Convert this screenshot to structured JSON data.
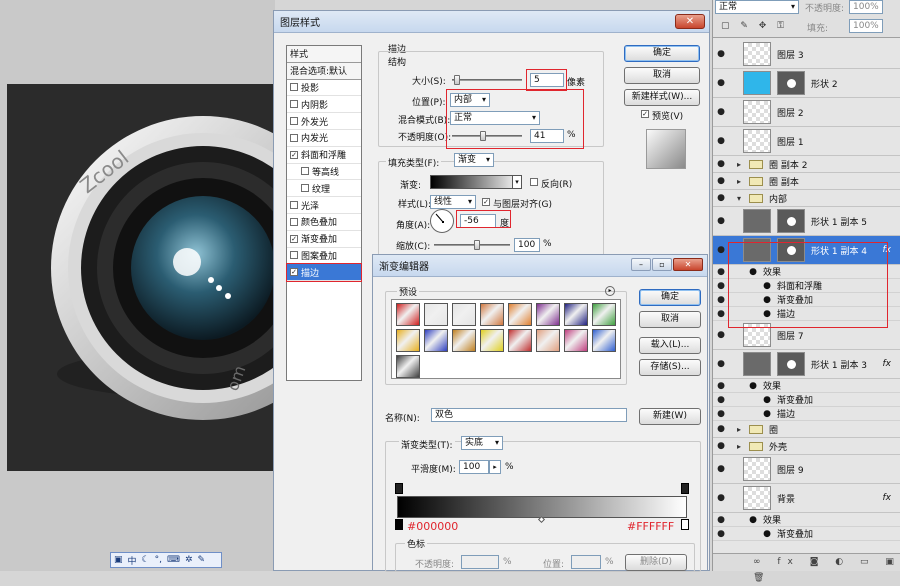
{
  "layer_style": {
    "title": "图层样式",
    "styles_header": "样式",
    "blend_options": "混合选项:默认",
    "items": [
      {
        "label": "投影",
        "checked": false,
        "sub": false
      },
      {
        "label": "内阴影",
        "checked": false,
        "sub": false
      },
      {
        "label": "外发光",
        "checked": false,
        "sub": false
      },
      {
        "label": "内发光",
        "checked": false,
        "sub": false
      },
      {
        "label": "斜面和浮雕",
        "checked": true,
        "sub": false
      },
      {
        "label": "等高线",
        "checked": false,
        "sub": true
      },
      {
        "label": "纹理",
        "checked": false,
        "sub": true
      },
      {
        "label": "光泽",
        "checked": false,
        "sub": false
      },
      {
        "label": "颜色叠加",
        "checked": false,
        "sub": false
      },
      {
        "label": "渐变叠加",
        "checked": true,
        "sub": false
      },
      {
        "label": "图案叠加",
        "checked": false,
        "sub": false
      },
      {
        "label": "描边",
        "checked": true,
        "sub": false,
        "selected": true
      }
    ],
    "stroke": {
      "section_title": "描边",
      "structure_title": "结构",
      "size_label": "大小(S):",
      "size_value": "5",
      "size_unit": "像素",
      "position_label": "位置(P):",
      "position_value": "内部",
      "blend_label": "混合模式(B):",
      "blend_value": "正常",
      "opacity_label": "不透明度(O):",
      "opacity_value": "41",
      "opacity_unit": "%",
      "fill_type_label": "填充类型(F):",
      "fill_type_value": "渐变",
      "gradient_label": "渐变:",
      "reverse_label": "反向(R)",
      "style_label": "样式(L):",
      "style_value": "线性",
      "align_label": "与图层对齐(G)",
      "angle_label": "角度(A):",
      "angle_value": "-56",
      "angle_unit": "度",
      "scale_label": "缩放(C):",
      "scale_value": "100",
      "scale_unit": "%"
    },
    "buttons": {
      "ok": "确定",
      "cancel": "取消",
      "new_style": "新建样式(W)...",
      "preview": "预览(V)"
    }
  },
  "gradient_editor": {
    "title": "渐变编辑器",
    "presets_label": "预设",
    "buttons": {
      "ok": "确定",
      "cancel": "取消",
      "load": "载入(L)...",
      "save": "存储(S)...",
      "new": "新建(W)"
    },
    "name_label": "名称(N):",
    "name_value": "双色",
    "type_label": "渐变类型(T):",
    "type_value": "实底",
    "smooth_label": "平滑度(M):",
    "smooth_value": "100",
    "smooth_unit": "%",
    "stop_left_color": "#000000",
    "stop_right_color": "#FFFFFF",
    "stops_title": "色标",
    "opacity_label": "不透明度:",
    "opacity_unit": "%",
    "location_label": "位置:",
    "location_unit": "%",
    "delete_label": "删除(D)",
    "preset_colors": [
      [
        "#d02020",
        "#e6e6e6",
        "#e4e4e4",
        "#d07840",
        "#e08030",
        "#803090",
        "#202080",
        "#40a040"
      ],
      [
        "#e8b020",
        "#3040c0",
        "#c08020",
        "#e0d020",
        "#c03030",
        "#e0a080",
        "#c04080",
        "#3060d0"
      ],
      [
        "#404040"
      ]
    ]
  },
  "layers_panel": {
    "blend_mode": "正常",
    "opacity_label": "不透明度:",
    "opacity_value": "100%",
    "fill_label": "填充:",
    "fill_value": "100%",
    "rows": [
      {
        "name": "图层 3",
        "kind": "layer"
      },
      {
        "name": "形状 2",
        "kind": "shape"
      },
      {
        "name": "图层 2",
        "kind": "layer"
      },
      {
        "name": "图层 1",
        "kind": "layer"
      },
      {
        "name": "圈 副本 2",
        "kind": "group"
      },
      {
        "name": "圈 副本",
        "kind": "group"
      },
      {
        "name": "内部",
        "kind": "group-open"
      },
      {
        "name": "形状 1 副本 5",
        "kind": "shape"
      },
      {
        "name": "形状 1 副本 4",
        "kind": "shape",
        "selected": true
      },
      {
        "name": "效果",
        "kind": "effects"
      },
      {
        "name": "斜面和浮雕",
        "kind": "effect"
      },
      {
        "name": "渐变叠加",
        "kind": "effect"
      },
      {
        "name": "描边",
        "kind": "effect"
      },
      {
        "name": "图层 7",
        "kind": "layer"
      },
      {
        "name": "形状 1 副本 3",
        "kind": "shape"
      },
      {
        "name": "效果",
        "kind": "effects"
      },
      {
        "name": "渐变叠加",
        "kind": "effect"
      },
      {
        "name": "描边",
        "kind": "effect"
      },
      {
        "name": "圈",
        "kind": "group"
      },
      {
        "name": "外壳",
        "kind": "group"
      },
      {
        "name": "图层 9",
        "kind": "layer"
      },
      {
        "name": "背景",
        "kind": "layer"
      },
      {
        "name": "效果",
        "kind": "effects"
      },
      {
        "name": "渐变叠加",
        "kind": "effect"
      }
    ]
  },
  "canvas": {
    "lens_text_top": "Zcool",
    "lens_text_bottom": "om"
  },
  "ime_bar": {
    "text": "中"
  }
}
